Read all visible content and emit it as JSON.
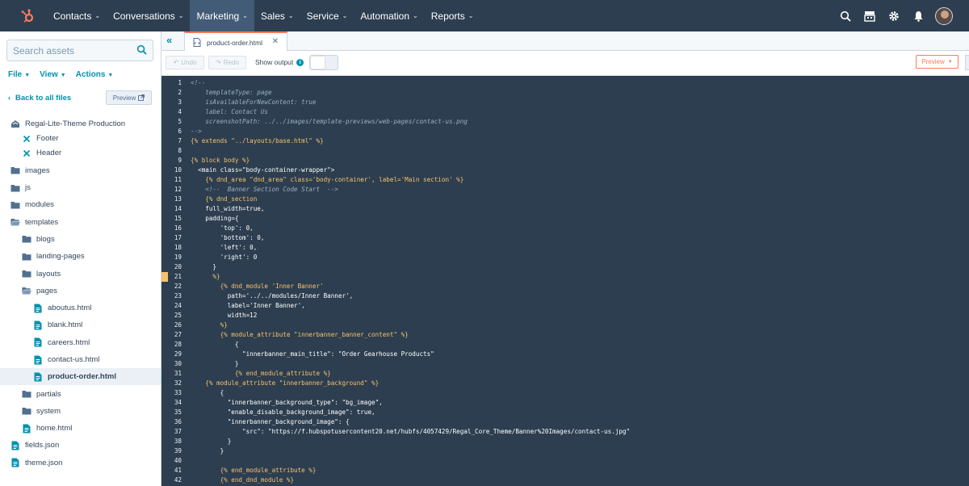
{
  "topnav": {
    "logo": "hubspot-sprocket-icon",
    "items": [
      {
        "label": "Contacts"
      },
      {
        "label": "Conversations"
      },
      {
        "label": "Marketing"
      },
      {
        "label": "Sales"
      },
      {
        "label": "Service"
      },
      {
        "label": "Automation"
      },
      {
        "label": "Reports"
      }
    ],
    "active_item": "Marketing",
    "right_icons": [
      "search-icon",
      "marketplace-icon",
      "settings-icon",
      "notifications-icon",
      "avatar"
    ]
  },
  "sidebar": {
    "search_placeholder": "Search assets",
    "menus": [
      {
        "label": "File"
      },
      {
        "label": "View"
      },
      {
        "label": "Actions"
      }
    ],
    "back_label": "Back to all files",
    "preview_label": "Preview",
    "tree": [
      {
        "label": "Regal-Lite-Theme Production",
        "icon": "theme-icon",
        "depth": 0
      },
      {
        "label": "Footer",
        "icon": "module-icon",
        "depth": 1
      },
      {
        "label": "Header",
        "icon": "module-icon",
        "depth": 1
      },
      {
        "label": "images",
        "icon": "folder-icon",
        "depth": 0
      },
      {
        "label": "js",
        "icon": "folder-icon",
        "depth": 0
      },
      {
        "label": "modules",
        "icon": "folder-icon",
        "depth": 0
      },
      {
        "label": "templates",
        "icon": "folder-open-icon",
        "depth": 0
      },
      {
        "label": "blogs",
        "icon": "folder-icon",
        "depth": 1
      },
      {
        "label": "landing-pages",
        "icon": "folder-icon",
        "depth": 1
      },
      {
        "label": "layouts",
        "icon": "folder-icon",
        "depth": 1
      },
      {
        "label": "pages",
        "icon": "folder-open-icon",
        "depth": 1
      },
      {
        "label": "aboutus.html",
        "icon": "file-icon",
        "depth": 2
      },
      {
        "label": "blank.html",
        "icon": "file-icon",
        "depth": 2
      },
      {
        "label": "careers.html",
        "icon": "file-icon",
        "depth": 2
      },
      {
        "label": "contact-us.html",
        "icon": "file-icon",
        "depth": 2
      },
      {
        "label": "product-order.html",
        "icon": "file-icon",
        "depth": 2,
        "selected": true
      },
      {
        "label": "partials",
        "icon": "folder-icon",
        "depth": 1
      },
      {
        "label": "system",
        "icon": "folder-icon",
        "depth": 1
      },
      {
        "label": "home.html",
        "icon": "file-icon",
        "depth": 1
      },
      {
        "label": "fields.json",
        "icon": "file-icon",
        "depth": 0
      },
      {
        "label": "theme.json",
        "icon": "file-icon",
        "depth": 0
      }
    ]
  },
  "editor": {
    "tab_label": "product-order.html",
    "undo_label": "Undo",
    "redo_label": "Redo",
    "show_output_label": "Show output",
    "preview_label": "Preview",
    "lines": [
      {
        "n": "1",
        "text": "<!--",
        "cls": "cm-comment"
      },
      {
        "n": "2",
        "text": "    templateType: page",
        "cls": "cm-comment"
      },
      {
        "n": "3",
        "text": "    isAvailableForNewContent: true",
        "cls": "cm-comment"
      },
      {
        "n": "4",
        "text": "    label: Contact Us",
        "cls": "cm-comment"
      },
      {
        "n": "5",
        "text": "    screenshotPath: ../../images/template-previews/web-pages/contact-us.png",
        "cls": "cm-comment"
      },
      {
        "n": "6",
        "text": "-->",
        "cls": "cm-comment"
      },
      {
        "n": "7",
        "text": "{% extends \"../layouts/base.html\" %}",
        "cls": "cm-tag"
      },
      {
        "n": "8",
        "text": "",
        "cls": ""
      },
      {
        "n": "9",
        "text": "{% block body %}",
        "cls": "cm-tag"
      },
      {
        "n": "10",
        "text": "  <main class=\"body-container-wrapper\">",
        "cls": "cm-str"
      },
      {
        "n": "11",
        "text": "    {% dnd_area \"dnd_area\" class='body-container', label='Main section' %}",
        "cls": "cm-tag"
      },
      {
        "n": "12",
        "text": "    <!--  Banner Section Code Start  -->",
        "cls": "cm-comment"
      },
      {
        "n": "13",
        "text": "    {% dnd_section",
        "cls": "cm-tag"
      },
      {
        "n": "14",
        "text": "    full_width=true,",
        "cls": "cm-str"
      },
      {
        "n": "15",
        "text": "    padding={",
        "cls": "cm-str"
      },
      {
        "n": "16",
        "text": "        'top': 0,",
        "cls": "cm-str"
      },
      {
        "n": "17",
        "text": "        'bottom': 0,",
        "cls": "cm-str"
      },
      {
        "n": "18",
        "text": "        'left': 0,",
        "cls": "cm-str"
      },
      {
        "n": "19",
        "text": "        'right': 0",
        "cls": "cm-str"
      },
      {
        "n": "20",
        "text": "      }",
        "cls": "cm-str"
      },
      {
        "n": "21",
        "text": "      %}",
        "cls": "cm-tag"
      },
      {
        "n": "22",
        "text": "        {% dnd_module 'Inner Banner'",
        "cls": "cm-tag"
      },
      {
        "n": "23",
        "text": "          path='../../modules/Inner Banner',",
        "cls": "cm-str"
      },
      {
        "n": "24",
        "text": "          label='Inner Banner',",
        "cls": "cm-str"
      },
      {
        "n": "25",
        "text": "          width=12",
        "cls": "cm-str"
      },
      {
        "n": "26",
        "text": "        %}",
        "cls": "cm-tag"
      },
      {
        "n": "27",
        "text": "        {% module_attribute \"innerbanner_banner_content\" %}",
        "cls": "cm-tag"
      },
      {
        "n": "28",
        "text": "            {",
        "cls": "cm-str"
      },
      {
        "n": "29",
        "text": "              \"innerbanner_main_title\": \"Order Gearhouse Products\"",
        "cls": "cm-str"
      },
      {
        "n": "30",
        "text": "            }",
        "cls": "cm-str"
      },
      {
        "n": "31",
        "text": "            {% end_module_attribute %}",
        "cls": "cm-tag"
      },
      {
        "n": "32",
        "text": "    {% module_attribute \"innerbanner_background\" %}",
        "cls": "cm-tag"
      },
      {
        "n": "33",
        "text": "        {",
        "cls": "cm-str"
      },
      {
        "n": "34",
        "text": "          \"innerbanner_background_type\": \"bg_image\",",
        "cls": "cm-str"
      },
      {
        "n": "35",
        "text": "          \"enable_disable_background_image\": true,",
        "cls": "cm-str"
      },
      {
        "n": "36",
        "text": "          \"innerbanner_background_image\": {",
        "cls": "cm-str"
      },
      {
        "n": "37",
        "text": "              \"src\": \"https://f.hubspotusercontent20.net/hubfs/4057429/Regal_Core_Theme/Banner%20Images/contact-us.jpg\"",
        "cls": "cm-str"
      },
      {
        "n": "38",
        "text": "          }",
        "cls": "cm-str"
      },
      {
        "n": "39",
        "text": "        }",
        "cls": "cm-str"
      },
      {
        "n": "40",
        "text": "",
        "cls": ""
      },
      {
        "n": "41",
        "text": "        {% end_module_attribute %}",
        "cls": "cm-tag"
      },
      {
        "n": "42",
        "text": "        {% end_dnd_module %}",
        "cls": "cm-tag"
      }
    ],
    "marked_line": "21"
  },
  "colors": {
    "nav_bg": "#2d3e50",
    "editor_bg": "#2d3e50",
    "accent": "#ff7a59",
    "link": "#0091ae"
  }
}
